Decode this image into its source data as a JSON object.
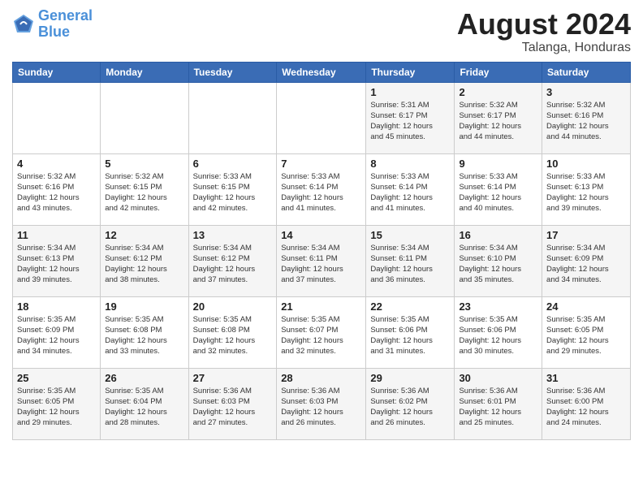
{
  "logo": {
    "line1": "General",
    "line2": "Blue"
  },
  "title": "August 2024",
  "subtitle": "Talanga, Honduras",
  "headers": [
    "Sunday",
    "Monday",
    "Tuesday",
    "Wednesday",
    "Thursday",
    "Friday",
    "Saturday"
  ],
  "weeks": [
    [
      {
        "day": "",
        "info": ""
      },
      {
        "day": "",
        "info": ""
      },
      {
        "day": "",
        "info": ""
      },
      {
        "day": "",
        "info": ""
      },
      {
        "day": "1",
        "info": "Sunrise: 5:31 AM\nSunset: 6:17 PM\nDaylight: 12 hours\nand 45 minutes."
      },
      {
        "day": "2",
        "info": "Sunrise: 5:32 AM\nSunset: 6:17 PM\nDaylight: 12 hours\nand 44 minutes."
      },
      {
        "day": "3",
        "info": "Sunrise: 5:32 AM\nSunset: 6:16 PM\nDaylight: 12 hours\nand 44 minutes."
      }
    ],
    [
      {
        "day": "4",
        "info": "Sunrise: 5:32 AM\nSunset: 6:16 PM\nDaylight: 12 hours\nand 43 minutes."
      },
      {
        "day": "5",
        "info": "Sunrise: 5:32 AM\nSunset: 6:15 PM\nDaylight: 12 hours\nand 42 minutes."
      },
      {
        "day": "6",
        "info": "Sunrise: 5:33 AM\nSunset: 6:15 PM\nDaylight: 12 hours\nand 42 minutes."
      },
      {
        "day": "7",
        "info": "Sunrise: 5:33 AM\nSunset: 6:14 PM\nDaylight: 12 hours\nand 41 minutes."
      },
      {
        "day": "8",
        "info": "Sunrise: 5:33 AM\nSunset: 6:14 PM\nDaylight: 12 hours\nand 41 minutes."
      },
      {
        "day": "9",
        "info": "Sunrise: 5:33 AM\nSunset: 6:14 PM\nDaylight: 12 hours\nand 40 minutes."
      },
      {
        "day": "10",
        "info": "Sunrise: 5:33 AM\nSunset: 6:13 PM\nDaylight: 12 hours\nand 39 minutes."
      }
    ],
    [
      {
        "day": "11",
        "info": "Sunrise: 5:34 AM\nSunset: 6:13 PM\nDaylight: 12 hours\nand 39 minutes."
      },
      {
        "day": "12",
        "info": "Sunrise: 5:34 AM\nSunset: 6:12 PM\nDaylight: 12 hours\nand 38 minutes."
      },
      {
        "day": "13",
        "info": "Sunrise: 5:34 AM\nSunset: 6:12 PM\nDaylight: 12 hours\nand 37 minutes."
      },
      {
        "day": "14",
        "info": "Sunrise: 5:34 AM\nSunset: 6:11 PM\nDaylight: 12 hours\nand 37 minutes."
      },
      {
        "day": "15",
        "info": "Sunrise: 5:34 AM\nSunset: 6:11 PM\nDaylight: 12 hours\nand 36 minutes."
      },
      {
        "day": "16",
        "info": "Sunrise: 5:34 AM\nSunset: 6:10 PM\nDaylight: 12 hours\nand 35 minutes."
      },
      {
        "day": "17",
        "info": "Sunrise: 5:34 AM\nSunset: 6:09 PM\nDaylight: 12 hours\nand 34 minutes."
      }
    ],
    [
      {
        "day": "18",
        "info": "Sunrise: 5:35 AM\nSunset: 6:09 PM\nDaylight: 12 hours\nand 34 minutes."
      },
      {
        "day": "19",
        "info": "Sunrise: 5:35 AM\nSunset: 6:08 PM\nDaylight: 12 hours\nand 33 minutes."
      },
      {
        "day": "20",
        "info": "Sunrise: 5:35 AM\nSunset: 6:08 PM\nDaylight: 12 hours\nand 32 minutes."
      },
      {
        "day": "21",
        "info": "Sunrise: 5:35 AM\nSunset: 6:07 PM\nDaylight: 12 hours\nand 32 minutes."
      },
      {
        "day": "22",
        "info": "Sunrise: 5:35 AM\nSunset: 6:06 PM\nDaylight: 12 hours\nand 31 minutes."
      },
      {
        "day": "23",
        "info": "Sunrise: 5:35 AM\nSunset: 6:06 PM\nDaylight: 12 hours\nand 30 minutes."
      },
      {
        "day": "24",
        "info": "Sunrise: 5:35 AM\nSunset: 6:05 PM\nDaylight: 12 hours\nand 29 minutes."
      }
    ],
    [
      {
        "day": "25",
        "info": "Sunrise: 5:35 AM\nSunset: 6:05 PM\nDaylight: 12 hours\nand 29 minutes."
      },
      {
        "day": "26",
        "info": "Sunrise: 5:35 AM\nSunset: 6:04 PM\nDaylight: 12 hours\nand 28 minutes."
      },
      {
        "day": "27",
        "info": "Sunrise: 5:36 AM\nSunset: 6:03 PM\nDaylight: 12 hours\nand 27 minutes."
      },
      {
        "day": "28",
        "info": "Sunrise: 5:36 AM\nSunset: 6:03 PM\nDaylight: 12 hours\nand 26 minutes."
      },
      {
        "day": "29",
        "info": "Sunrise: 5:36 AM\nSunset: 6:02 PM\nDaylight: 12 hours\nand 26 minutes."
      },
      {
        "day": "30",
        "info": "Sunrise: 5:36 AM\nSunset: 6:01 PM\nDaylight: 12 hours\nand 25 minutes."
      },
      {
        "day": "31",
        "info": "Sunrise: 5:36 AM\nSunset: 6:00 PM\nDaylight: 12 hours\nand 24 minutes."
      }
    ]
  ]
}
